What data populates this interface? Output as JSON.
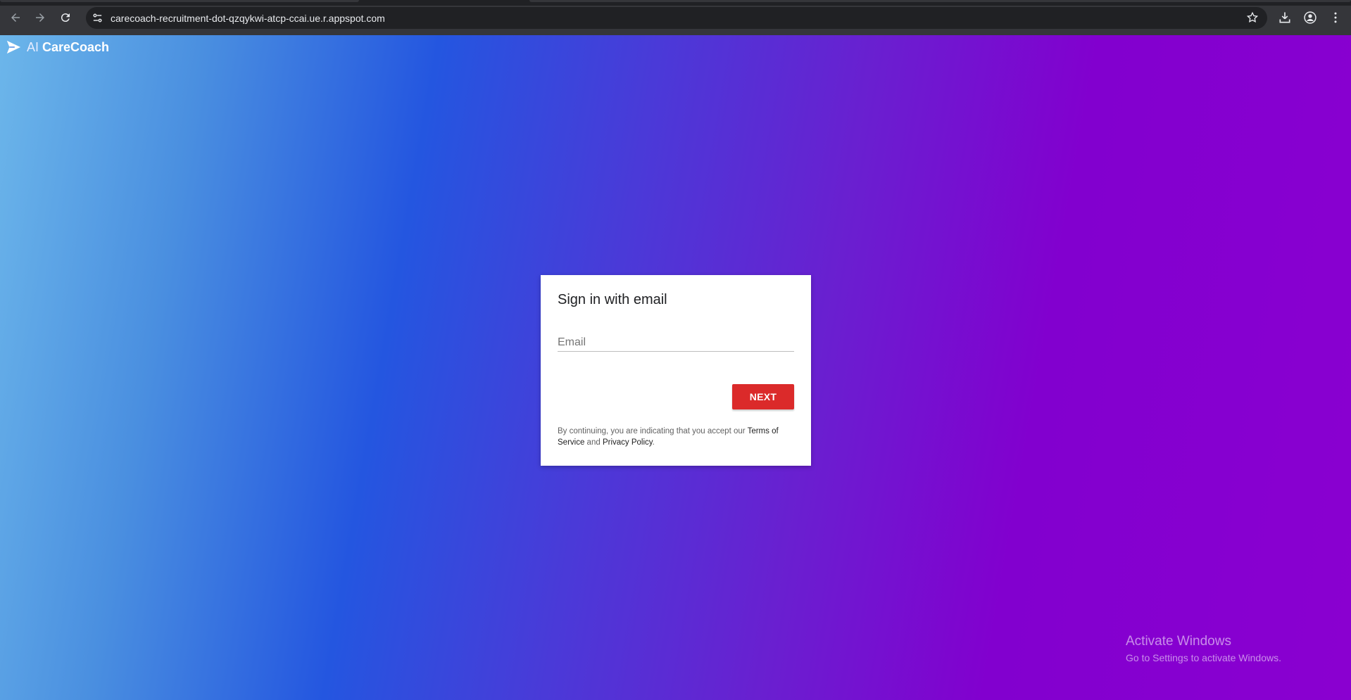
{
  "browser": {
    "url": "carecoach-recruitment-dot-qzqykwi-atcp-ccai.ue.r.appspot.com",
    "icons": [
      "back-arrow-icon",
      "forward-arrow-icon",
      "reload-icon",
      "site-settings-icon",
      "bookmark-star-icon",
      "download-icon",
      "profile-icon",
      "more-menu-icon"
    ]
  },
  "brand": {
    "prefix": "AI",
    "name": "CareCoach"
  },
  "signin": {
    "title": "Sign in with email",
    "email_placeholder": "Email",
    "email_value": "",
    "next_label": "NEXT",
    "legal_prefix": "By continuing, you are indicating that you accept our ",
    "terms_label": "Terms of Service",
    "legal_and": " and ",
    "privacy_label": "Privacy Policy",
    "legal_suffix": "."
  },
  "watermark": {
    "title": "Activate Windows",
    "subtitle": "Go to Settings to activate Windows."
  },
  "colors": {
    "chrome_bar": "#35363a",
    "omnibox": "#202124",
    "next_button": "#db2a2a",
    "gradient_left": "#6cb6ea",
    "gradient_mid": "#2456e0",
    "gradient_right": "#8a00d0"
  }
}
